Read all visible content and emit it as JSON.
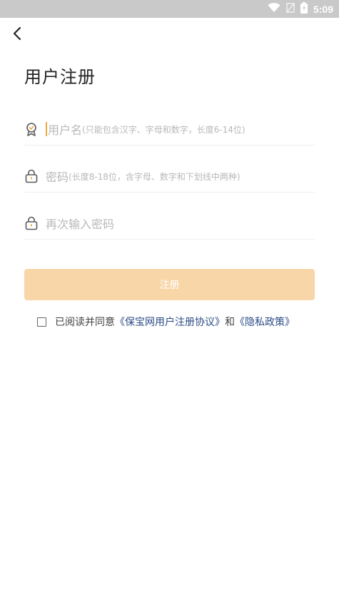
{
  "status_bar": {
    "time": "5:09",
    "icons": [
      "wifi-icon",
      "signal-icon",
      "battery-icon"
    ]
  },
  "header": {
    "back_icon": "chevron-left-icon",
    "title": "用户注册"
  },
  "form": {
    "username": {
      "icon": "badge-icon",
      "placeholder_main": "用户名",
      "placeholder_hint": "(只能包含汉字、字母和数字，长度6-14位)"
    },
    "password": {
      "icon": "lock-icon",
      "placeholder_main": "密码",
      "placeholder_hint": "(长度8-18位，含字母、数字和下划线中两种)"
    },
    "confirm_password": {
      "icon": "lock-icon",
      "placeholder_main": "再次输入密码"
    }
  },
  "register_button": {
    "label": "注册"
  },
  "agreement": {
    "prefix": "已阅读并同意",
    "user_agreement": "《保宝网用户注册协议》",
    "and": "和",
    "privacy_policy": "《隐私政策》",
    "checked": false
  },
  "colors": {
    "accent": "#f1a83c",
    "button_bg": "#f8d6a8",
    "link": "#2c4b86",
    "status_bar": "#c9c9c9"
  }
}
